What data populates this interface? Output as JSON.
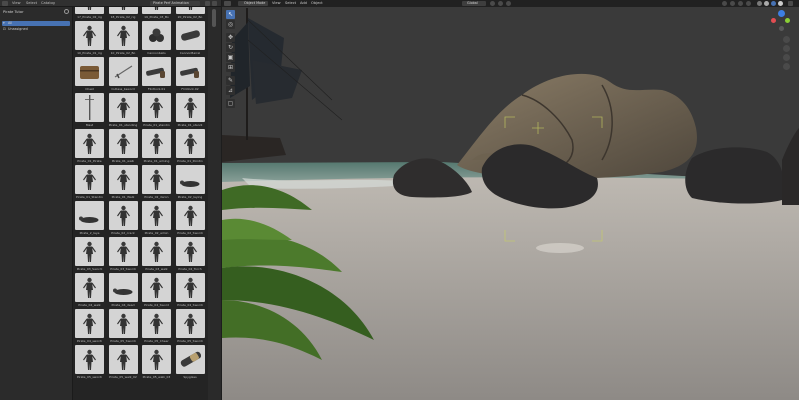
{
  "left_header": {
    "menu": [
      "View",
      "Select",
      "Catalog"
    ],
    "library": "Pirate Perf Animation"
  },
  "side_panel": {
    "title": "Pirate Tutor",
    "categories": [
      {
        "label": "All",
        "selected": true
      },
      {
        "label": "Unassigned",
        "selected": false
      }
    ]
  },
  "assets": [
    {
      "label": "17_Pirate_02_rig"
    },
    {
      "label": "18_Pirate_02_rig"
    },
    {
      "label": "19_Pirate_03_Bo"
    },
    {
      "label": "20_Pirate_02_Bo"
    },
    {
      "label": "10_Pirate_01_rig"
    },
    {
      "label": "10_Pirate_02_Bo"
    },
    {
      "label": "Cannonballs"
    },
    {
      "label": "CannonBarrel"
    },
    {
      "label": "Chest"
    },
    {
      "label": "Cutlass_bsword"
    },
    {
      "label": "Flintlock.01"
    },
    {
      "label": "Flintlock.02"
    },
    {
      "label": "Mast"
    },
    {
      "label": "Pirate_01_standing"
    },
    {
      "label": "Pirate_01_standin"
    },
    {
      "label": "Pirate_01_standi"
    },
    {
      "label": "Pirate_01_Pirate"
    },
    {
      "label": "Pirate_01_walk"
    },
    {
      "label": "Pirate_01_aiming"
    },
    {
      "label": "Pirate_01_Pointin"
    },
    {
      "label": "Pirate_01_Standin"
    },
    {
      "label": "Pirate_01_Walk"
    },
    {
      "label": "Pirate_02_daron"
    },
    {
      "label": "Pirate_02_laying"
    },
    {
      "label": "Pirate_2_laye"
    },
    {
      "label": "Pirate_02_crack"
    },
    {
      "label": "Pirate_02_aimin"
    },
    {
      "label": "Pirate_02_Swordi"
    },
    {
      "label": "Pirate_03_Swordi"
    },
    {
      "label": "Pirate_03_Swordi"
    },
    {
      "label": "Pirate_03_walk"
    },
    {
      "label": "Pirate_04_Torch"
    },
    {
      "label": "Pirate_04_walk"
    },
    {
      "label": "Pirate_04_dead"
    },
    {
      "label": "Pirate_04_Sword"
    },
    {
      "label": "Pirate_04_Swordi"
    },
    {
      "label": "Pirate_04_swordi"
    },
    {
      "label": "Pirate_05_Swordi"
    },
    {
      "label": "Pirate_05_Cheer"
    },
    {
      "label": "Pirate_05_Swordi"
    },
    {
      "label": "Pirate_05_swordi"
    },
    {
      "label": "Pirate_05_walk_02"
    },
    {
      "label": "Pirate_05_walk_03"
    },
    {
      "label": "Spyglass"
    }
  ],
  "viewport_header": {
    "mode": "Object Mode",
    "menu": [
      "View",
      "Select",
      "Add",
      "Object"
    ],
    "orientation": "Global"
  },
  "toolbar": {
    "tools": [
      "cursor-tool",
      "select-tool",
      "move-tool",
      "rotate-tool",
      "scale-tool",
      "transform-tool",
      "annotate-tool",
      "measure-tool",
      "add-cube-tool"
    ]
  },
  "colors": {
    "accent": "#4772b3",
    "panel": "#2b2b2b",
    "header": "#303030",
    "thumbnail_bg": "#d4d4d4",
    "sky": "#3a3a3a",
    "sand": "#a7a39e",
    "rock": "#5e5448"
  },
  "icons": {
    "gizmo_x": "#e24d52",
    "gizmo_y": "#8bcf36",
    "gizmo_z": "#3d7fe3"
  }
}
